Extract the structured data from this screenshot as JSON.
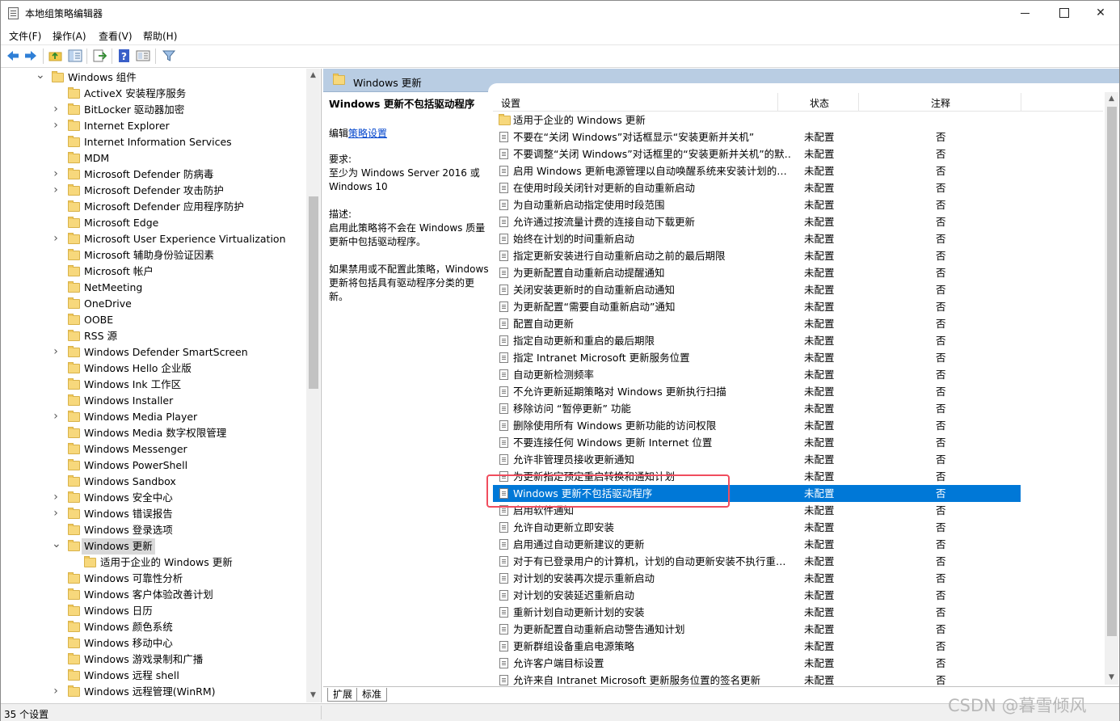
{
  "window": {
    "title": "本地组策略编辑器"
  },
  "menu": [
    "文件(F)",
    "操作(A)",
    "查看(V)",
    "帮助(H)"
  ],
  "toolbar": {
    "icons": [
      "back-arrow-icon",
      "forward-arrow-icon",
      "up-folder-icon",
      "show-hide-tree-icon",
      "export-list-icon",
      "help-icon",
      "properties-icon",
      "filter-icon"
    ]
  },
  "tree": {
    "items": [
      {
        "label": "Windows 组件",
        "level": 0,
        "expander": "expanded"
      },
      {
        "label": "ActiveX 安装程序服务",
        "level": 1,
        "expander": "none"
      },
      {
        "label": "BitLocker 驱动器加密",
        "level": 1,
        "expander": "collapsed"
      },
      {
        "label": "Internet Explorer",
        "level": 1,
        "expander": "collapsed"
      },
      {
        "label": "Internet Information Services",
        "level": 1,
        "expander": "none"
      },
      {
        "label": "MDM",
        "level": 1,
        "expander": "none"
      },
      {
        "label": "Microsoft Defender 防病毒",
        "level": 1,
        "expander": "collapsed"
      },
      {
        "label": "Microsoft Defender 攻击防护",
        "level": 1,
        "expander": "collapsed"
      },
      {
        "label": "Microsoft Defender 应用程序防护",
        "level": 1,
        "expander": "none"
      },
      {
        "label": "Microsoft Edge",
        "level": 1,
        "expander": "none"
      },
      {
        "label": "Microsoft User Experience Virtualization",
        "level": 1,
        "expander": "collapsed"
      },
      {
        "label": "Microsoft 辅助身份验证因素",
        "level": 1,
        "expander": "none"
      },
      {
        "label": "Microsoft 帐户",
        "level": 1,
        "expander": "none"
      },
      {
        "label": "NetMeeting",
        "level": 1,
        "expander": "none"
      },
      {
        "label": "OneDrive",
        "level": 1,
        "expander": "none"
      },
      {
        "label": "OOBE",
        "level": 1,
        "expander": "none"
      },
      {
        "label": "RSS 源",
        "level": 1,
        "expander": "none"
      },
      {
        "label": "Windows Defender SmartScreen",
        "level": 1,
        "expander": "collapsed"
      },
      {
        "label": "Windows Hello 企业版",
        "level": 1,
        "expander": "none"
      },
      {
        "label": "Windows Ink 工作区",
        "level": 1,
        "expander": "none"
      },
      {
        "label": "Windows Installer",
        "level": 1,
        "expander": "none"
      },
      {
        "label": "Windows Media Player",
        "level": 1,
        "expander": "collapsed"
      },
      {
        "label": "Windows Media 数字权限管理",
        "level": 1,
        "expander": "none"
      },
      {
        "label": "Windows Messenger",
        "level": 1,
        "expander": "none"
      },
      {
        "label": "Windows PowerShell",
        "level": 1,
        "expander": "none"
      },
      {
        "label": "Windows Sandbox",
        "level": 1,
        "expander": "none"
      },
      {
        "label": "Windows 安全中心",
        "level": 1,
        "expander": "collapsed"
      },
      {
        "label": "Windows 错误报告",
        "level": 1,
        "expander": "collapsed"
      },
      {
        "label": "Windows 登录选项",
        "level": 1,
        "expander": "none"
      },
      {
        "label": "Windows 更新",
        "level": 1,
        "expander": "expanded",
        "selected": true
      },
      {
        "label": "适用于企业的 Windows 更新",
        "level": 2,
        "expander": "none"
      },
      {
        "label": "Windows 可靠性分析",
        "level": 1,
        "expander": "none"
      },
      {
        "label": "Windows 客户体验改善计划",
        "level": 1,
        "expander": "none"
      },
      {
        "label": "Windows 日历",
        "level": 1,
        "expander": "none"
      },
      {
        "label": "Windows 颜色系统",
        "level": 1,
        "expander": "none"
      },
      {
        "label": "Windows 移动中心",
        "level": 1,
        "expander": "none"
      },
      {
        "label": "Windows 游戏录制和广播",
        "level": 1,
        "expander": "none"
      },
      {
        "label": "Windows 远程 shell",
        "level": 1,
        "expander": "none"
      },
      {
        "label": "Windows 远程管理(WinRM)",
        "level": 1,
        "expander": "collapsed"
      }
    ]
  },
  "right_header": {
    "title": "Windows 更新"
  },
  "description": {
    "title": "Windows 更新不包括驱动程序",
    "edit_prefix": "编辑",
    "edit_link": "策略设置",
    "requirements_label": "要求:",
    "requirements_text": "至少为 Windows Server 2016 或 Windows 10",
    "desc_label": "描述:",
    "desc_text": "启用此策略将不会在 Windows 质量更新中包括驱动程序。",
    "desc_text2": "如果禁用或不配置此策略，Windows 更新将包括具有驱动程序分类的更新。"
  },
  "columns": {
    "setting": "设置",
    "state": "状态",
    "comment": "注释"
  },
  "rows": [
    {
      "name": "适用于企业的 Windows 更新",
      "state": "",
      "note": "",
      "folder": true
    },
    {
      "name": "不要在“关闭 Windows”对话框显示“安装更新并关机”",
      "state": "未配置",
      "note": "否"
    },
    {
      "name": "不要调整“关闭 Windows”对话框里的“安装更新并关机”的默…",
      "state": "未配置",
      "note": "否"
    },
    {
      "name": "启用 Windows 更新电源管理以自动唤醒系统来安装计划的…",
      "state": "未配置",
      "note": "否"
    },
    {
      "name": "在使用时段关闭针对更新的自动重新启动",
      "state": "未配置",
      "note": "否"
    },
    {
      "name": "为自动重新启动指定使用时段范围",
      "state": "未配置",
      "note": "否"
    },
    {
      "name": "允许通过按流量计费的连接自动下载更新",
      "state": "未配置",
      "note": "否"
    },
    {
      "name": "始终在计划的时间重新启动",
      "state": "未配置",
      "note": "否"
    },
    {
      "name": "指定更新安装进行自动重新启动之前的最后期限",
      "state": "未配置",
      "note": "否"
    },
    {
      "name": "为更新配置自动重新启动提醒通知",
      "state": "未配置",
      "note": "否"
    },
    {
      "name": "关闭安装更新时的自动重新启动通知",
      "state": "未配置",
      "note": "否"
    },
    {
      "name": "为更新配置“需要自动重新启动”通知",
      "state": "未配置",
      "note": "否"
    },
    {
      "name": "配置自动更新",
      "state": "未配置",
      "note": "否"
    },
    {
      "name": "指定自动更新和重启的最后期限",
      "state": "未配置",
      "note": "否"
    },
    {
      "name": "指定 Intranet Microsoft 更新服务位置",
      "state": "未配置",
      "note": "否"
    },
    {
      "name": "自动更新检测频率",
      "state": "未配置",
      "note": "否"
    },
    {
      "name": "不允许更新延期策略对 Windows 更新执行扫描",
      "state": "未配置",
      "note": "否"
    },
    {
      "name": "移除访问 “暂停更新” 功能",
      "state": "未配置",
      "note": "否"
    },
    {
      "name": "删除使用所有 Windows 更新功能的访问权限",
      "state": "未配置",
      "note": "否"
    },
    {
      "name": "不要连接任何 Windows 更新 Internet 位置",
      "state": "未配置",
      "note": "否"
    },
    {
      "name": "允许非管理员接收更新通知",
      "state": "未配置",
      "note": "否"
    },
    {
      "name": "为更新指定预定重启转换和通知计划",
      "state": "未配置",
      "note": "否"
    },
    {
      "name": "Windows 更新不包括驱动程序",
      "state": "未配置",
      "note": "否",
      "selected": true
    },
    {
      "name": "启用软件通知",
      "state": "未配置",
      "note": "否"
    },
    {
      "name": "允许自动更新立即安装",
      "state": "未配置",
      "note": "否"
    },
    {
      "name": "启用通过自动更新建议的更新",
      "state": "未配置",
      "note": "否"
    },
    {
      "name": "对于有已登录用户的计算机，计划的自动更新安装不执行重…",
      "state": "未配置",
      "note": "否"
    },
    {
      "name": "对计划的安装再次提示重新启动",
      "state": "未配置",
      "note": "否"
    },
    {
      "name": "对计划的安装延迟重新启动",
      "state": "未配置",
      "note": "否"
    },
    {
      "name": "重新计划自动更新计划的安装",
      "state": "未配置",
      "note": "否"
    },
    {
      "name": "为更新配置自动重新启动警告通知计划",
      "state": "未配置",
      "note": "否"
    },
    {
      "name": "更新群组设备重启电源策略",
      "state": "未配置",
      "note": "否"
    },
    {
      "name": "允许客户端目标设置",
      "state": "未配置",
      "note": "否"
    },
    {
      "name": "允许来自 Intranet Microsoft 更新服务位置的签名更新",
      "state": "未配置",
      "note": "否"
    }
  ],
  "tabs": [
    "扩展",
    "标准"
  ],
  "status": {
    "text": "35 个设置"
  },
  "watermark": "CSDN @暮雪倾风",
  "colors": {
    "selection": "#0078d7",
    "header_band": "#b9cde3",
    "highlight_box": "#f04d5e"
  }
}
